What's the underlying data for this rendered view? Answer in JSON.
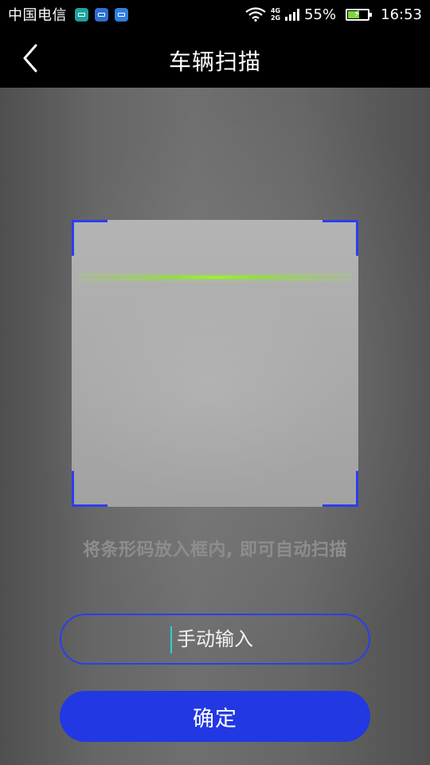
{
  "status_bar": {
    "carrier": "中国电信",
    "app_icons": [
      "app-icon-teal",
      "app-icon-blue",
      "gallery-icon"
    ],
    "network_top": "4G",
    "network_bottom": "2G",
    "battery": "55%",
    "battery_level": 0.55,
    "time": "16:53"
  },
  "header": {
    "title": "车辆扫描",
    "back_icon": "chevron-left-icon"
  },
  "scanner": {
    "hint": "将条形码放入框内, 即可自动扫描",
    "corner_color": "#2b3ef0",
    "scan_line_color": "#9cf03a"
  },
  "manual_input": {
    "placeholder": "手动输入",
    "value": ""
  },
  "confirm_button": {
    "label": "确定",
    "color": "#2238e2"
  }
}
